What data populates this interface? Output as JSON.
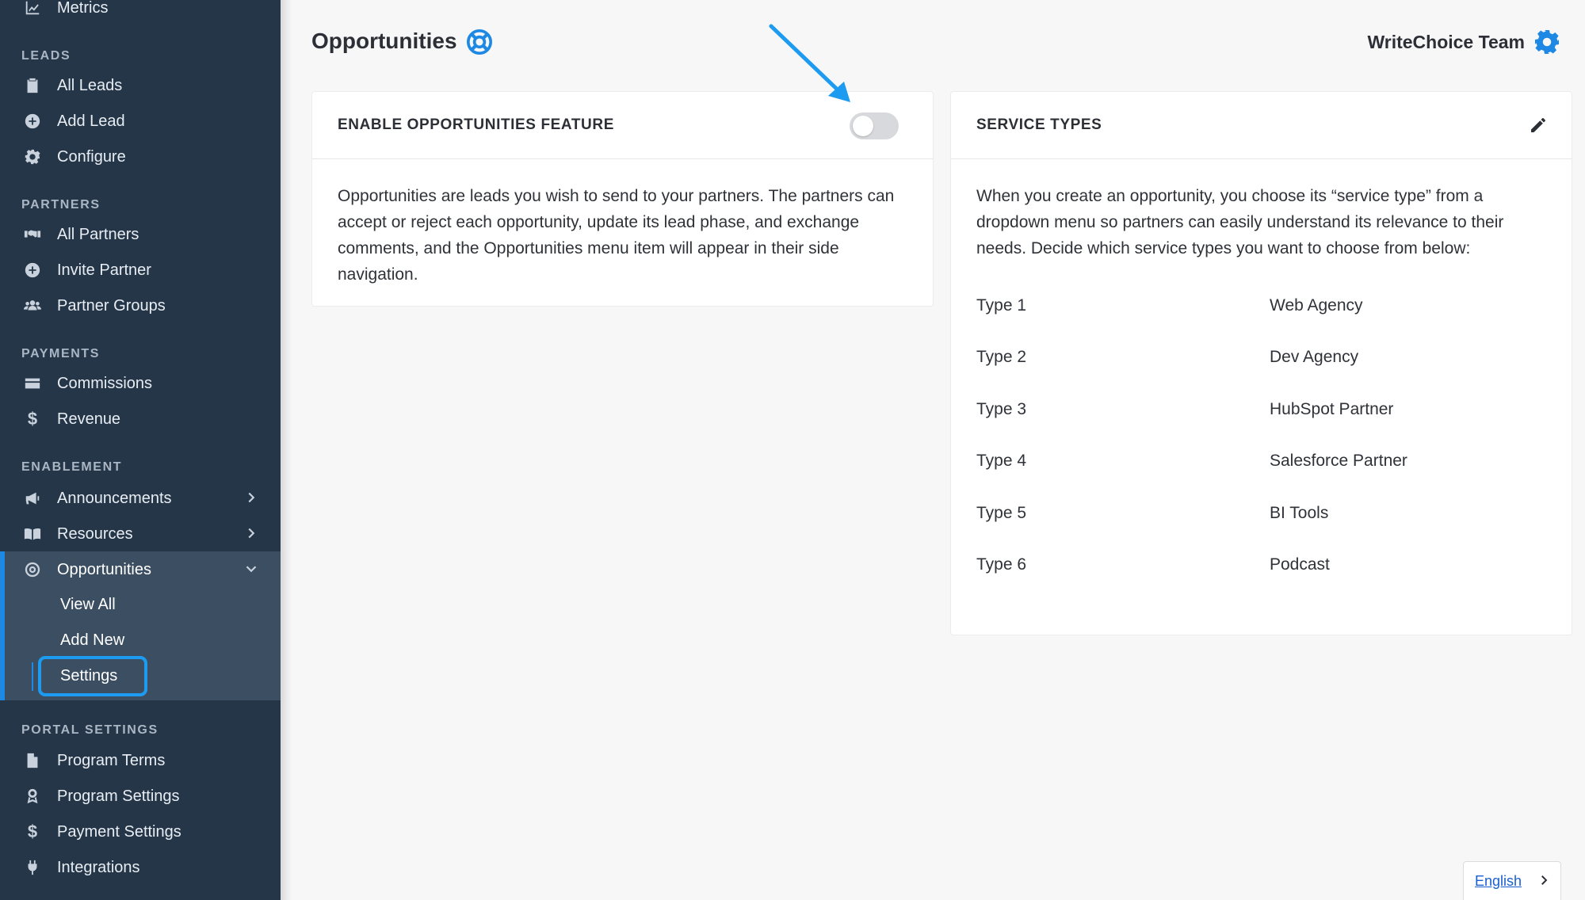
{
  "sidebar": {
    "top_item": "Metrics",
    "sections": {
      "leads": "LEADS",
      "partners": "PARTNERS",
      "payments": "PAYMENTS",
      "enablement": "ENABLEMENT",
      "portal_settings": "PORTAL SETTINGS"
    },
    "leads_items": [
      "All Leads",
      "Add Lead",
      "Configure"
    ],
    "partners_items": [
      "All Partners",
      "Invite Partner",
      "Partner Groups"
    ],
    "payments_items": [
      "Commissions",
      "Revenue"
    ],
    "enablement_items": [
      "Announcements",
      "Resources",
      "Opportunities"
    ],
    "opportunities_sub": [
      "View All",
      "Add New",
      "Settings"
    ],
    "portal_items": [
      "Program Terms",
      "Program Settings",
      "Payment Settings",
      "Integrations"
    ]
  },
  "header": {
    "title": "Opportunities",
    "team": "WriteChoice Team"
  },
  "feature_card": {
    "title": "ENABLE OPPORTUNITIES FEATURE",
    "enabled": false,
    "body": "Opportunities are leads you wish to send to your partners. The partners can accept or reject each opportunity, update its lead phase, and exchange comments, and the Opportunities menu item will appear in their side navigation."
  },
  "service_card": {
    "title": "SERVICE TYPES",
    "body": "When you create an opportunity, you choose its “service type” from a dropdown menu so partners can easily understand its relevance to their needs. Decide which service types you want to choose from below:",
    "types": [
      {
        "label": "Type 1",
        "value": "Web Agency"
      },
      {
        "label": "Type 2",
        "value": "Dev Agency"
      },
      {
        "label": "Type 3",
        "value": "HubSpot Partner"
      },
      {
        "label": "Type 4",
        "value": "Salesforce Partner"
      },
      {
        "label": "Type 5",
        "value": "BI Tools"
      },
      {
        "label": "Type 6",
        "value": "Podcast"
      }
    ]
  },
  "language": "English",
  "colors": {
    "sidebar": "#243648",
    "accent": "#1e88e5",
    "highlight": "#1d9bf0"
  }
}
